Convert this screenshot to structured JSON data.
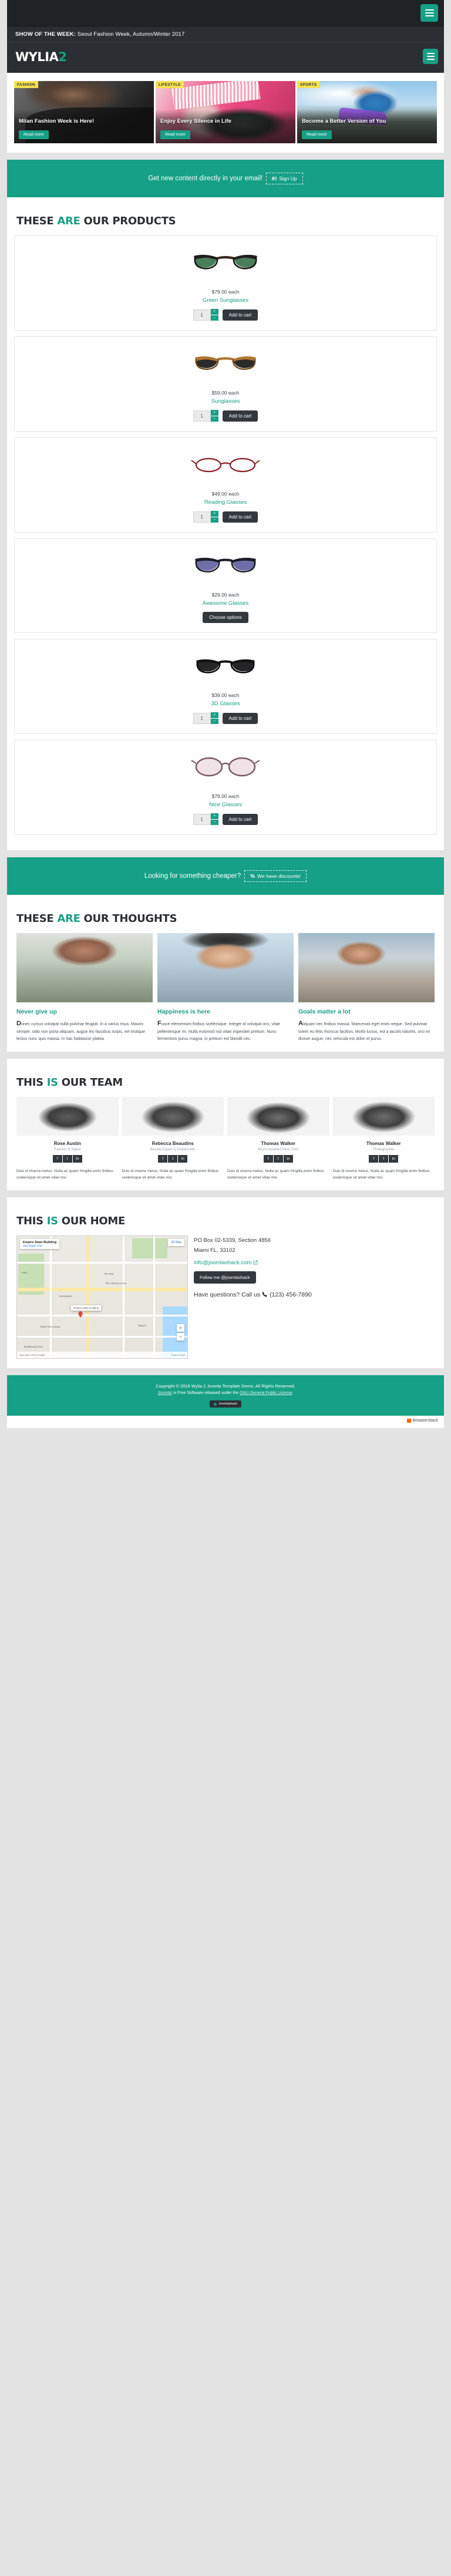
{
  "header": {
    "show_label": "SHOW OF THE WEEK:",
    "show_text": " Seoul Fashion Week, Autumn/Winter 2017",
    "logo_main": "WYLIA",
    "logo_accent": "2",
    "menu_icon": "hamburger-menu-icon"
  },
  "features": [
    {
      "tag": "FASHION",
      "title": "Milan Fashion Week is Here!",
      "button": "Read more"
    },
    {
      "tag": "LIFESTYLE",
      "title": "Enjoy Every Silence in Life",
      "button": "Read more"
    },
    {
      "tag": "SPORTS",
      "title": "Become a Better Version of You",
      "button": "Read more"
    }
  ],
  "newsletter": {
    "text": "Get new content directly in your email!",
    "button": "Sign Up",
    "icon": "newspaper-icon"
  },
  "products_section": {
    "t1": "THESE ",
    "t2": "ARE",
    "t3": " OUR PRODUCTS"
  },
  "products": [
    {
      "price": "$79.00 each",
      "name": "Green Sunglasses",
      "qty": "1",
      "button": "Add to cart",
      "style": "green"
    },
    {
      "price": "$59.00 each",
      "name": "Sunglasses",
      "qty": "1",
      "button": "Add to cart",
      "style": "amber"
    },
    {
      "price": "$49.00 each",
      "name": "Reading Glasses",
      "qty": "1",
      "button": "Add to cart",
      "style": "reading"
    },
    {
      "price": "$29.00 each",
      "name": "Awesome Glasses",
      "qty": "",
      "button": "Choose options",
      "style": "awesome"
    },
    {
      "price": "$39.00 each",
      "name": "3D Glasses",
      "qty": "1",
      "button": "Add to cart",
      "style": "threed"
    },
    {
      "price": "$79.00 each",
      "name": "Nice Glasses",
      "qty": "1",
      "button": "Add to cart",
      "style": "nice"
    }
  ],
  "discount": {
    "text": "Looking for something cheaper?",
    "button": "We have discounts!",
    "icon": "percent-icon"
  },
  "thoughts_section": {
    "t1": "THESE ",
    "t2": "ARE",
    "t3": " OUR THOUGHTS"
  },
  "thoughts": [
    {
      "title": "Never give up",
      "body": "Donec cursus volutpat nulla pulvinar feugiat. In a varius risus. Mauris semper, odio non porta aliquam, augue leo faucibus turpis, vel tristique lectus nunc quis massa. In hac habitasse platea."
    },
    {
      "title": "Happiness is here",
      "body": "Fusce elementum finibus scelerisque. Integer id volutpat orci, vitae pellentesque mi. Nulla euismod nisl vitae imperdiet pretium. Nunc fermentum purus magna, in pretium est blandit nec."
    },
    {
      "title": "Goals matter a lot",
      "body": "Aliquam nec finibus massa. Maecenas eget enim neque. Sed pulvinar lorem eu felis rhoncus facilisis. Morbi luctus, est a iaculis lobortis, orci mi dictum augue, nec vehicula est dolor et purus."
    }
  ],
  "team_section": {
    "t1": "THIS ",
    "t2": "IS",
    "t3": " OUR TEAM"
  },
  "team": [
    {
      "name": "Rose Austin",
      "role": "Fashion & Stylist",
      "socials": [
        "f",
        "t",
        "in"
      ],
      "bio": "Duis id viverra metus. Nulla ac quam fringilla enim finibus scelerisque sit amet vitae nisi."
    },
    {
      "name": "Rebecca Beaudins",
      "role": "Beauty Expert & Globetrotter",
      "socials": [
        "f",
        "t",
        "in"
      ],
      "bio": "Duis id viverra metus. Nulla ac quam fringilla enim finibus scelerisque sit amet vitae nisi."
    },
    {
      "name": "Thomas Walker",
      "role": "Much travelled Paris Chef",
      "socials": [
        "f",
        "t",
        "in"
      ],
      "bio": "Duis id viverra metus. Nulla ac quam fringilla enim finibus scelerisque sit amet vitae nisi."
    },
    {
      "name": "Thomas Walker",
      "role": "Photographer",
      "socials": [
        "f",
        "t",
        "in"
      ],
      "bio": "Duis id viverra metus. Nulla ac quam fringilla enim finibus scelerisque sit amet vitae nisi."
    }
  ],
  "home_section": {
    "t1": "THIS ",
    "t2": "IS",
    "t3": " OUR HOME"
  },
  "map": {
    "title": "Empire State Building",
    "link": "View larger map",
    "expand": "3D Map",
    "marker_label": "Empire State Building",
    "poi_1": "The Mor",
    "poi_2": "The Library & Mus",
    "poi_3": "BOB Tofu House",
    "poi_4": "Baekjeong NYC",
    "poi_5": "Park",
    "poi_6": "Macy's",
    "poi_7": "Koreatown",
    "zoom_in": "+",
    "zoom_out": "−",
    "attribution": "Map data ©2018 Google",
    "terms": "Terms of Use"
  },
  "contact": {
    "address_1": "PO Box 02-5339, Section 4856",
    "address_2": "Miami FL, 33102",
    "email": "info@joomlashack.com",
    "email_icon": "external-link-icon",
    "follow_button": "Follow me @joomlashack",
    "question_text": "Have questions? Call us",
    "phone": "(123) 456-7890",
    "phone_icon": "phone-icon"
  },
  "footer": {
    "copyright": "Copyright © 2018 Wylia 2 Joomla Template Demo. All Rights Reserved.",
    "license_pre": "Joomla!",
    "license_mid": " is Free Software released under the ",
    "license_link": "GNU General Public License",
    "license_post": ".",
    "badge": "Joomlashack",
    "browserstack": "BrowserStack"
  }
}
